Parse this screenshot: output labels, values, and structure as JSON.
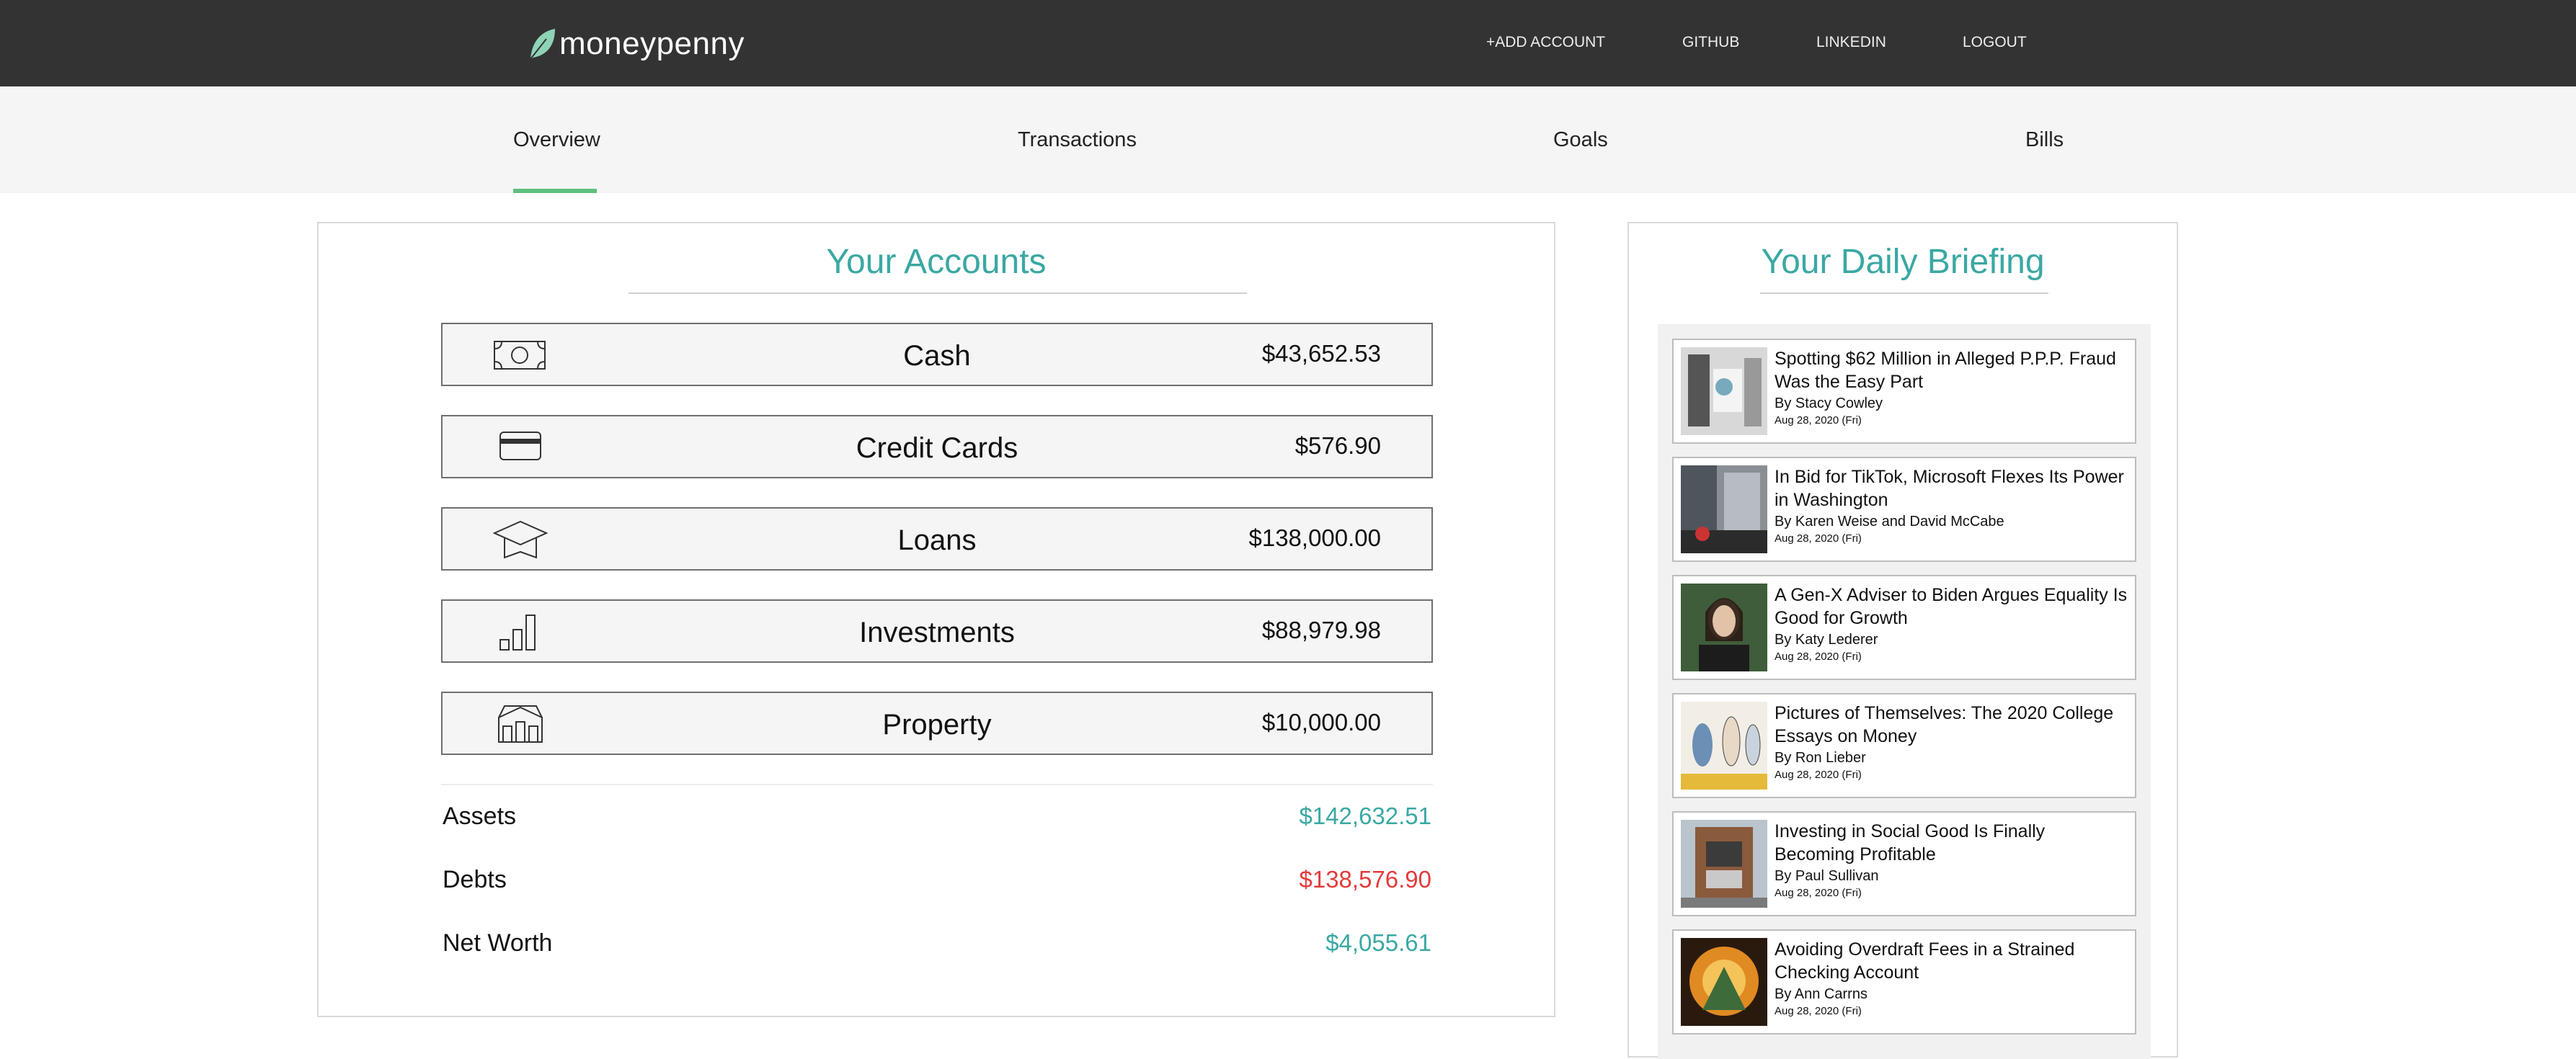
{
  "brand": {
    "name": "moneypenny",
    "accent": "#3aa8a3",
    "tab_indicator": "#5ec07e",
    "debt_color": "#e23b3b"
  },
  "topnav": {
    "add_account": "+ADD ACCOUNT",
    "github": "GITHUB",
    "linkedin": "LINKEDIN",
    "logout": "LOGOUT"
  },
  "tabs": [
    "Overview",
    "Transactions",
    "Goals",
    "Bills"
  ],
  "active_tab": "Overview",
  "accounts": {
    "title": "Your Accounts",
    "items": [
      {
        "name": "Cash",
        "amount": "$43,652.53",
        "icon": "cash-icon"
      },
      {
        "name": "Credit Cards",
        "amount": "$576.90",
        "icon": "credit-card-icon"
      },
      {
        "name": "Loans",
        "amount": "$138,000.00",
        "icon": "graduation-cap-icon"
      },
      {
        "name": "Investments",
        "amount": "$88,979.98",
        "icon": "bar-chart-icon"
      },
      {
        "name": "Property",
        "amount": "$10,000.00",
        "icon": "house-icon"
      }
    ],
    "summary": {
      "assets_label": "Assets",
      "assets_value": "$142,632.51",
      "debts_label": "Debts",
      "debts_value": "$138,576.90",
      "networth_label": "Net Worth",
      "networth_value": "$4,055.61"
    }
  },
  "briefing": {
    "title": "Your Daily Briefing",
    "articles": [
      {
        "title": "Spotting $62 Million in Alleged P.P.P. Fraud Was the Easy Part",
        "author": "By Stacy Cowley",
        "date": "Aug 28, 2020 (Fri)"
      },
      {
        "title": "In Bid for TikTok, Microsoft Flexes Its Power in Washington",
        "author": "By Karen Weise and David McCabe",
        "date": "Aug 28, 2020 (Fri)"
      },
      {
        "title": "A Gen-X Adviser to Biden Argues Equality Is Good for Growth",
        "author": "By Katy Lederer",
        "date": "Aug 28, 2020 (Fri)"
      },
      {
        "title": "Pictures of Themselves: The 2020 College Essays on Money",
        "author": "By Ron Lieber",
        "date": "Aug 28, 2020 (Fri)"
      },
      {
        "title": "Investing in Social Good Is Finally Becoming Profitable",
        "author": "By Paul Sullivan",
        "date": "Aug 28, 2020 (Fri)"
      },
      {
        "title": "Avoiding Overdraft Fees in a Strained Checking Account",
        "author": "By Ann Carrns",
        "date": "Aug 28, 2020 (Fri)"
      }
    ]
  }
}
